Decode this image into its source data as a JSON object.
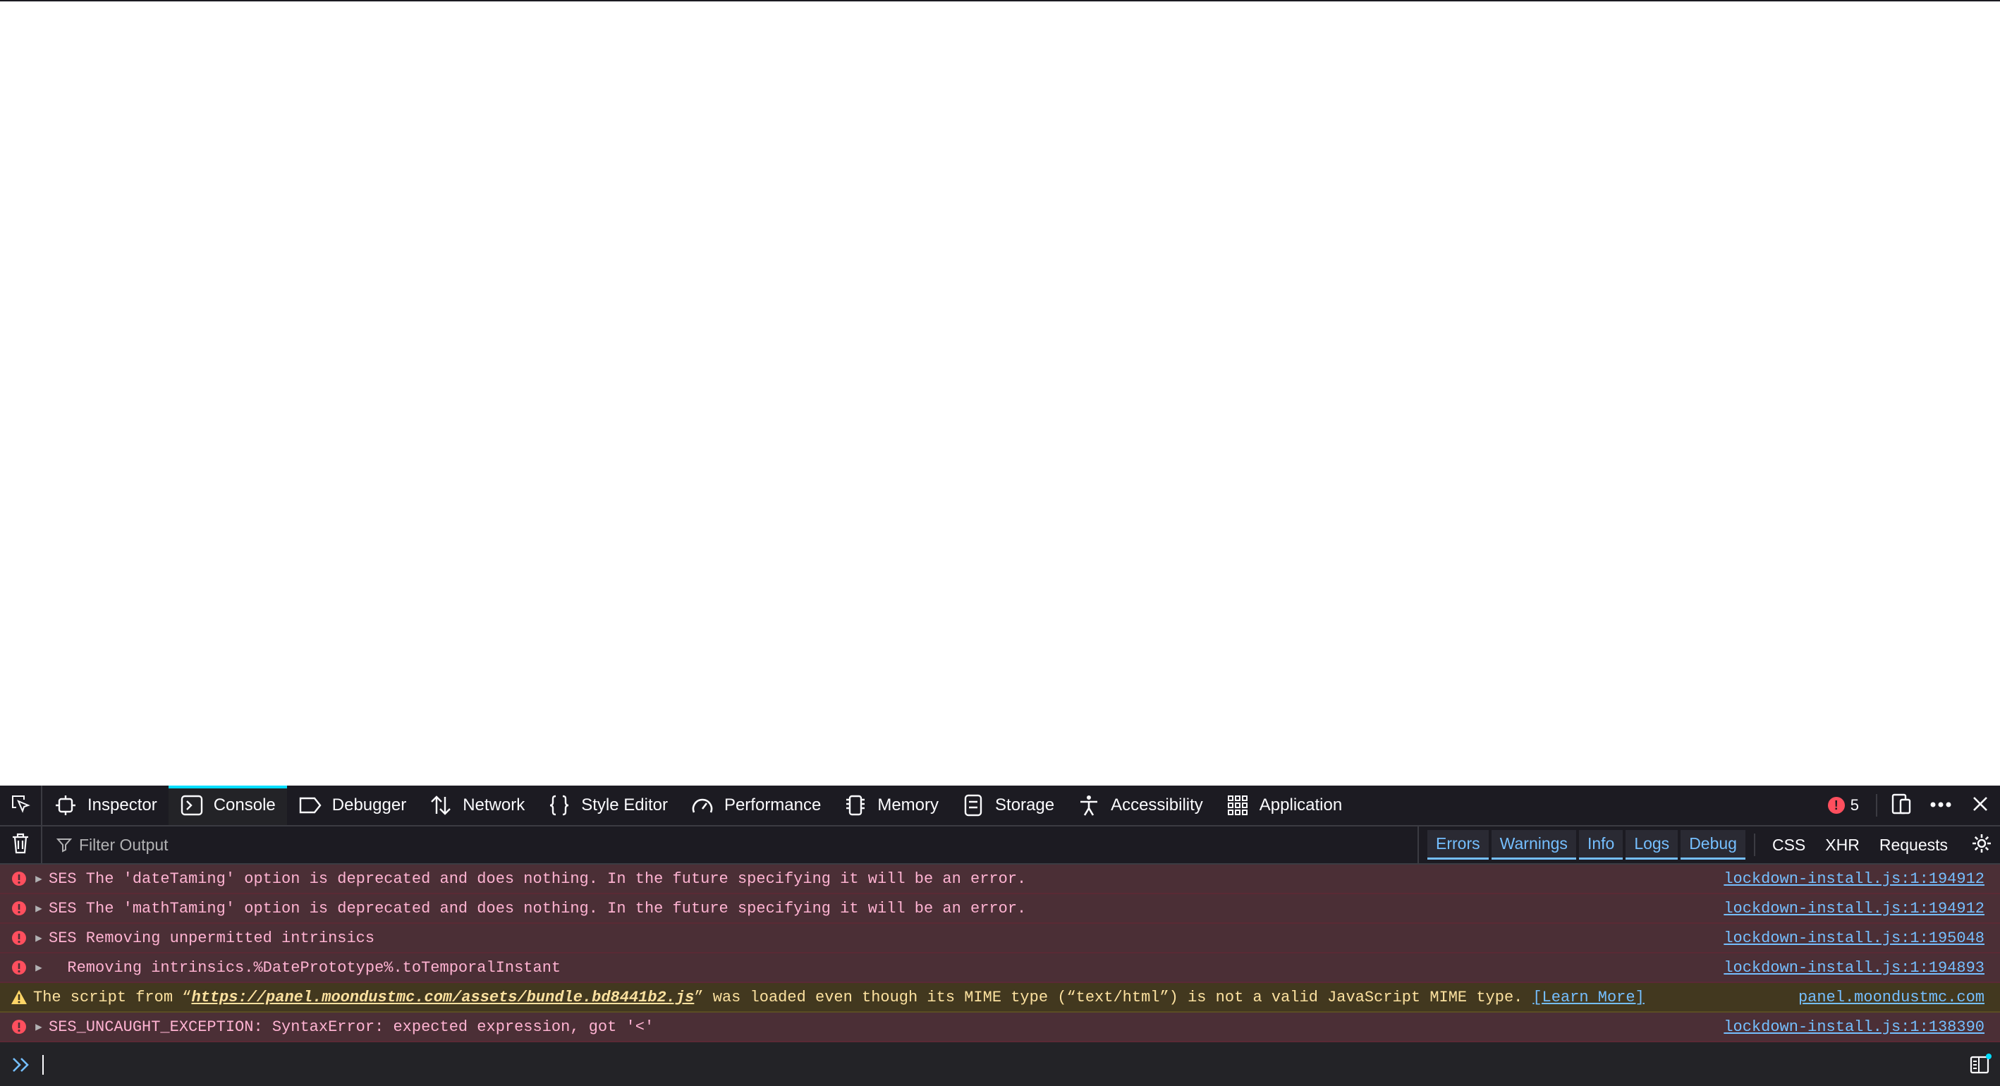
{
  "toolbar": {
    "tabs": [
      {
        "label": "Inspector",
        "icon": "inspector-icon"
      },
      {
        "label": "Console",
        "icon": "console-icon",
        "active": true
      },
      {
        "label": "Debugger",
        "icon": "debugger-icon"
      },
      {
        "label": "Network",
        "icon": "network-icon"
      },
      {
        "label": "Style Editor",
        "icon": "style-editor-icon"
      },
      {
        "label": "Performance",
        "icon": "performance-icon"
      },
      {
        "label": "Memory",
        "icon": "memory-icon"
      },
      {
        "label": "Storage",
        "icon": "storage-icon"
      },
      {
        "label": "Accessibility",
        "icon": "accessibility-icon"
      },
      {
        "label": "Application",
        "icon": "application-icon"
      }
    ],
    "error_count": "5",
    "accent_color": "#00ddff"
  },
  "filterbar": {
    "placeholder": "Filter Output",
    "levels": [
      {
        "label": "Errors",
        "on": true
      },
      {
        "label": "Warnings",
        "on": true
      },
      {
        "label": "Info",
        "on": true
      },
      {
        "label": "Logs",
        "on": true
      },
      {
        "label": "Debug",
        "on": true
      }
    ],
    "types": [
      {
        "label": "CSS"
      },
      {
        "label": "XHR"
      },
      {
        "label": "Requests"
      }
    ]
  },
  "messages": [
    {
      "level": "error",
      "expandable": true,
      "text": "SES The 'dateTaming' option is deprecated and does nothing. In the future specifying it will be an error.",
      "source": "lockdown-install.js:1:194912"
    },
    {
      "level": "error",
      "expandable": true,
      "text": "SES The 'mathTaming' option is deprecated and does nothing. In the future specifying it will be an error.",
      "source": "lockdown-install.js:1:194912"
    },
    {
      "level": "error",
      "expandable": true,
      "text": "SES Removing unpermitted intrinsics",
      "source": "lockdown-install.js:1:195048"
    },
    {
      "level": "error",
      "expandable": true,
      "text": "  Removing intrinsics.%DatePrototype%.toTemporalInstant",
      "source": "lockdown-install.js:1:194893"
    },
    {
      "level": "warn",
      "expandable": false,
      "text_before": "The script from “",
      "link": "https://panel.moondustmc.com/assets/bundle.bd8441b2.js",
      "text_after": "” was loaded even though its MIME type (“text/html”) is not a valid JavaScript MIME type.",
      "learn_more": "[Learn More]",
      "source": "panel.moondustmc.com"
    },
    {
      "level": "error",
      "expandable": true,
      "text": "SES_UNCAUGHT_EXCEPTION: SyntaxError: expected expression, got '<'",
      "source": "lockdown-install.js:1:138390"
    }
  ],
  "colors": {
    "error_bg": "#4b2f36",
    "error_text": "#ffb3d2",
    "warn_bg": "#42381f",
    "warn_text": "#fce19f",
    "link": "#75bfff"
  }
}
